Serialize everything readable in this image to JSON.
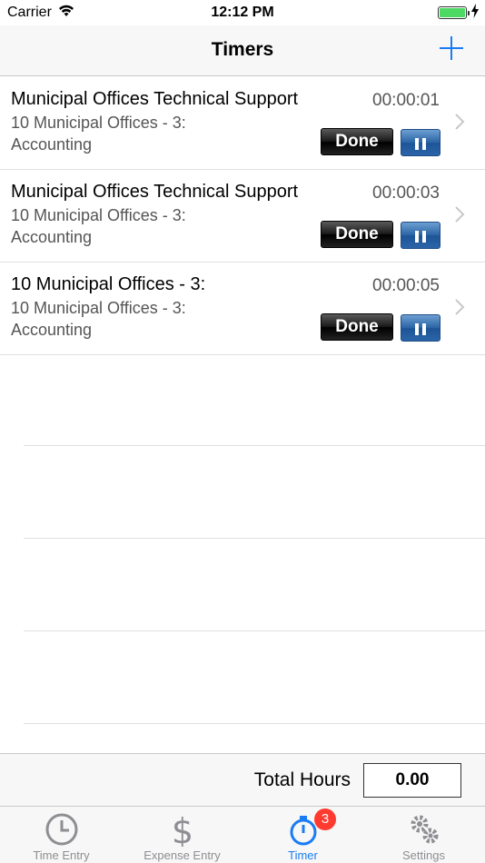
{
  "status_bar": {
    "carrier": "Carrier",
    "time": "12:12 PM"
  },
  "nav": {
    "title": "Timers",
    "add_icon": "plus-icon"
  },
  "timers": [
    {
      "title": "Municipal Offices Technical Support",
      "elapsed": "00:00:01",
      "subtitle_line1": "10 Municipal Offices - 3:",
      "subtitle_line2": "Accounting",
      "done_label": "Done"
    },
    {
      "title": "Municipal Offices Technical Support",
      "elapsed": "00:00:03",
      "subtitle_line1": "10 Municipal Offices - 3:",
      "subtitle_line2": "Accounting",
      "done_label": "Done"
    },
    {
      "title": "10 Municipal Offices - 3:",
      "elapsed": "00:00:05",
      "subtitle_line1": "10 Municipal Offices - 3:",
      "subtitle_line2": "Accounting",
      "done_label": "Done"
    }
  ],
  "total": {
    "label": "Total Hours",
    "value": "0.00"
  },
  "tabs": [
    {
      "label": "Time Entry",
      "icon": "clock-icon"
    },
    {
      "label": "Expense Entry",
      "icon": "dollar-icon"
    },
    {
      "label": "Timer",
      "icon": "stopwatch-icon",
      "badge": "3",
      "active": true
    },
    {
      "label": "Settings",
      "icon": "gears-icon"
    }
  ],
  "colors": {
    "accent": "#1a7cf4",
    "badge": "#ff3b30",
    "battery": "#4cd964"
  }
}
